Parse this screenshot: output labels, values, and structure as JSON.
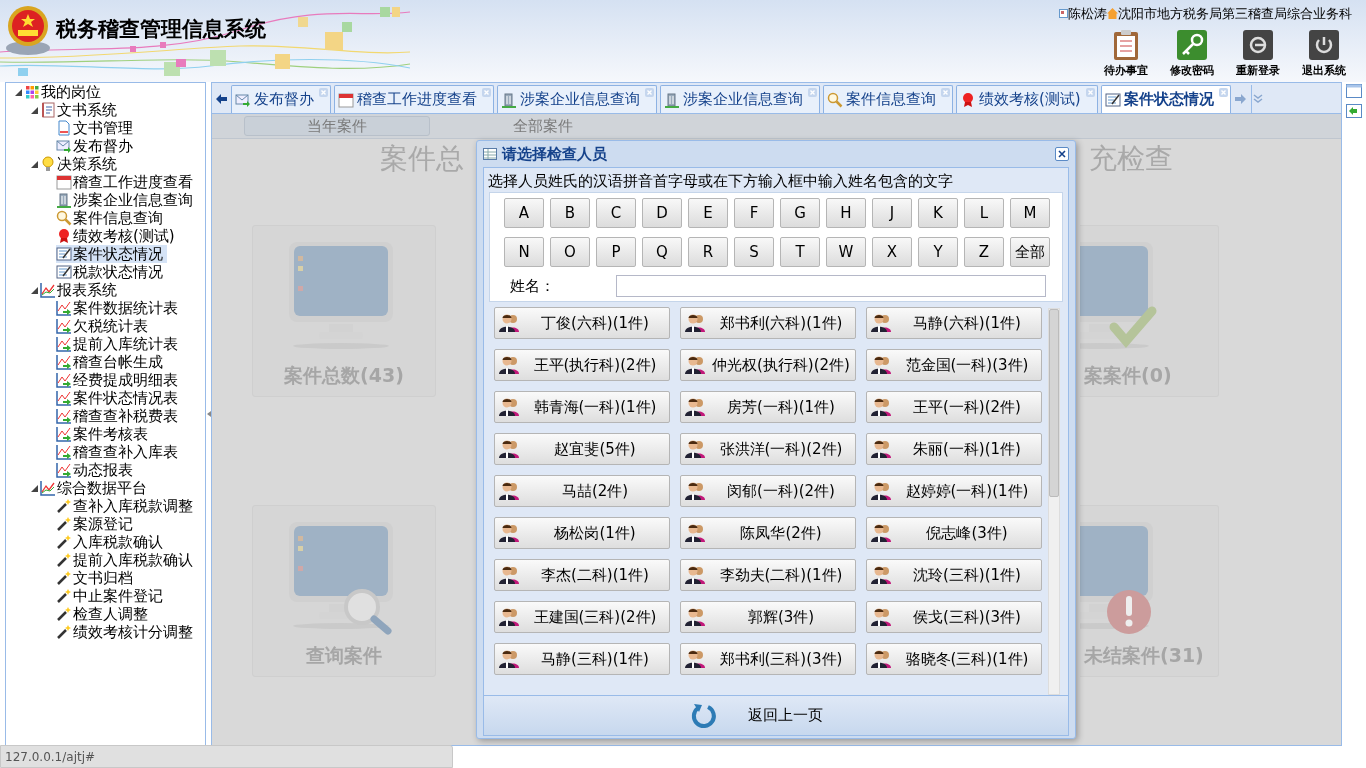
{
  "header": {
    "title": "税务稽查管理信息系统",
    "user": "陈松涛",
    "org": "沈阳市地方税务局第三稽查局综合业务科",
    "actions": [
      {
        "label": "待办事宜",
        "kind": "clipboard"
      },
      {
        "label": "修改密码",
        "kind": "key"
      },
      {
        "label": "重新登录",
        "kind": "relogin"
      },
      {
        "label": "退出系统",
        "kind": "power"
      }
    ]
  },
  "sidebar": [
    {
      "label": "我的岗位",
      "kind": "grid",
      "expanded": true,
      "selected": false,
      "children": [
        {
          "label": "文书系统",
          "kind": "book",
          "expanded": true,
          "selected": false,
          "children": [
            {
              "label": "文书管理",
              "kind": "doc",
              "selected": false
            },
            {
              "label": "发布督办",
              "kind": "mail",
              "selected": false
            }
          ]
        },
        {
          "label": "决策系统",
          "kind": "bulb",
          "expanded": true,
          "selected": false,
          "children": [
            {
              "label": "稽查工作进度查看",
              "kind": "calendar",
              "selected": false
            },
            {
              "label": "涉案企业信息查询",
              "kind": "building",
              "selected": false
            },
            {
              "label": "案件信息查询",
              "kind": "search",
              "selected": false
            },
            {
              "label": "绩效考核(测试)",
              "kind": "award",
              "selected": false
            },
            {
              "label": "案件状态情况",
              "kind": "form",
              "selected": true
            },
            {
              "label": "税款状态情况",
              "kind": "form",
              "selected": false
            }
          ]
        },
        {
          "label": "报表系统",
          "kind": "chart",
          "expanded": true,
          "selected": false,
          "children": [
            {
              "label": "案件数据统计表",
              "kind": "report",
              "selected": false
            },
            {
              "label": "欠税统计表",
              "kind": "report",
              "selected": false
            },
            {
              "label": "提前入库统计表",
              "kind": "report",
              "selected": false
            },
            {
              "label": "稽查台帐生成",
              "kind": "report",
              "selected": false
            },
            {
              "label": "经费提成明细表",
              "kind": "report",
              "selected": false
            },
            {
              "label": "案件状态情况表",
              "kind": "report",
              "selected": false
            },
            {
              "label": "稽查查补税费表",
              "kind": "report",
              "selected": false
            },
            {
              "label": "案件考核表",
              "kind": "report",
              "selected": false
            },
            {
              "label": "稽查查补入库表",
              "kind": "report",
              "selected": false
            },
            {
              "label": "动态报表",
              "kind": "report",
              "selected": false
            }
          ]
        },
        {
          "label": "综合数据平台",
          "kind": "chart",
          "expanded": true,
          "selected": false,
          "children": [
            {
              "label": "查补入库税款调整",
              "kind": "wand",
              "selected": false
            },
            {
              "label": "案源登记",
              "kind": "wand",
              "selected": false
            },
            {
              "label": "入库税款确认",
              "kind": "wand",
              "selected": false
            },
            {
              "label": "提前入库税款确认",
              "kind": "wand",
              "selected": false
            },
            {
              "label": "文书归档",
              "kind": "wand",
              "selected": false
            },
            {
              "label": "中止案件登记",
              "kind": "wand",
              "selected": false
            },
            {
              "label": "检查人调整",
              "kind": "wand",
              "selected": false
            },
            {
              "label": "绩效考核计分调整",
              "kind": "wand",
              "selected": false
            }
          ]
        }
      ]
    }
  ],
  "tabs": [
    {
      "label": "发布督办",
      "kind": "mail",
      "selected": false
    },
    {
      "label": "稽查工作进度查看",
      "kind": "calendar",
      "selected": false
    },
    {
      "label": "涉案企业信息查询",
      "kind": "building",
      "selected": false
    },
    {
      "label": "涉案企业信息查询",
      "kind": "building",
      "selected": false
    },
    {
      "label": "案件信息查询",
      "kind": "search",
      "selected": false
    },
    {
      "label": "绩效考核(测试)",
      "kind": "award",
      "selected": false
    },
    {
      "label": "案件状态情况",
      "kind": "form",
      "selected": true
    }
  ],
  "subtabs": [
    {
      "label": "当年案件",
      "selected": true
    },
    {
      "label": "全部案件",
      "selected": false
    }
  ],
  "background": {
    "heading_left": "案件总",
    "heading_right": "充检查",
    "cards": [
      {
        "label": "案件总数(43)",
        "kind": "plain"
      },
      {
        "label": "案案件(0)",
        "kind": "check"
      },
      {
        "label": "查询案件",
        "kind": "search"
      },
      {
        "label": "未结案件(31)",
        "kind": "alert"
      }
    ]
  },
  "dialog": {
    "title": "请选择检查人员",
    "instruction": "选择人员姓氏的汉语拼音首字母或在下方输入框中输入姓名包含的文字",
    "letters": [
      "A",
      "B",
      "C",
      "D",
      "E",
      "F",
      "G",
      "H",
      "J",
      "K",
      "L",
      "M",
      "N",
      "O",
      "P",
      "Q",
      "R",
      "S",
      "T",
      "W",
      "X",
      "Y",
      "Z",
      "全部"
    ],
    "name_label": "姓名：",
    "persons": [
      "丁俊(六科)(1件)",
      "郑书利(六科)(1件)",
      "马静(六科)(1件)",
      "王平(执行科)(2件)",
      "仲光权(执行科)(2件)",
      "范金国(一科)(3件)",
      "韩青海(一科)(1件)",
      "房芳(一科)(1件)",
      "王平(一科)(2件)",
      "赵宜斐(5件)",
      "张洪洋(一科)(2件)",
      "朱丽(一科)(1件)",
      "马喆(2件)",
      "闵郁(一科)(2件)",
      "赵婷婷(一科)(1件)",
      "杨松岗(1件)",
      "陈凤华(2件)",
      "倪志峰(3件)",
      "李杰(二科)(1件)",
      "李劲夫(二科)(1件)",
      "沈玲(三科)(1件)",
      "王建国(三科)(2件)",
      "郭辉(3件)",
      "侯戈(三科)(3件)",
      "马静(三科)(1件)",
      "郑书利(三科)(3件)",
      "骆晓冬(三科)(1件)"
    ],
    "back_label": "返回上一页"
  },
  "status_bar": "127.0.0.1/ajtj#"
}
